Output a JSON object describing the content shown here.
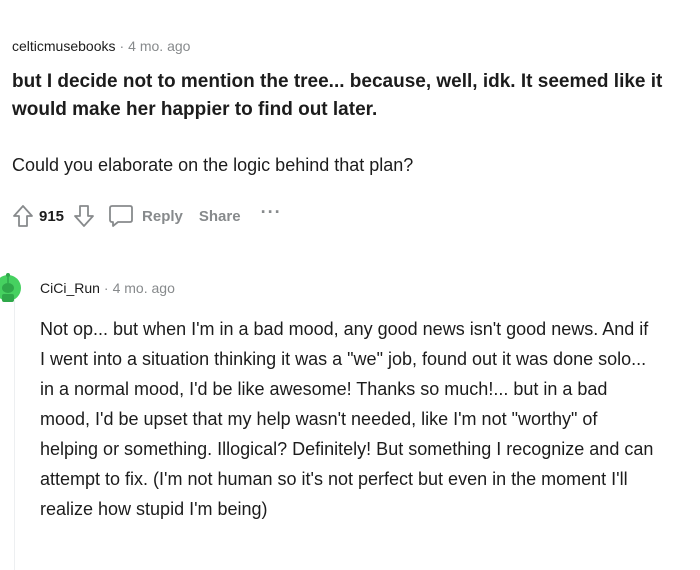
{
  "parent_comment": {
    "username": "celticmusebooks",
    "separator": "·",
    "timestamp": "4 mo. ago",
    "quote": "but I decide not to mention the tree... because, well, idk. It seemed like it would make her happier to find out later.",
    "body": "Could you elaborate on the logic behind that plan?",
    "vote_count": "915",
    "reply_label": "Reply",
    "share_label": "Share",
    "more_label": "···"
  },
  "reply_comment": {
    "username": "CiCi_Run",
    "separator": "·",
    "timestamp": "4 mo. ago",
    "body": "Not op... but when I'm in a bad mood, any good news isn't good news. And if I went into a situation thinking it was a \"we\" job, found out it was done solo... in a normal mood, I'd be like awesome! Thanks so much!... but in a bad mood, I'd be upset that my help wasn't needed, like I'm not \"worthy\" of helping or something. Illogical? Definitely! But something I recognize and can attempt to fix. (I'm not human so it's not perfect but even in the moment I'll realize how stupid I'm being)"
  },
  "colors": {
    "text": "#1c1c1c",
    "meta": "#878a8c",
    "avatar_green": "#46d160",
    "thread_line": "#edeff1"
  },
  "icons": {
    "upvote": "upvote-arrow-icon",
    "downvote": "downvote-arrow-icon",
    "reply": "speech-bubble-icon",
    "avatar": "snoo-avatar-icon"
  }
}
